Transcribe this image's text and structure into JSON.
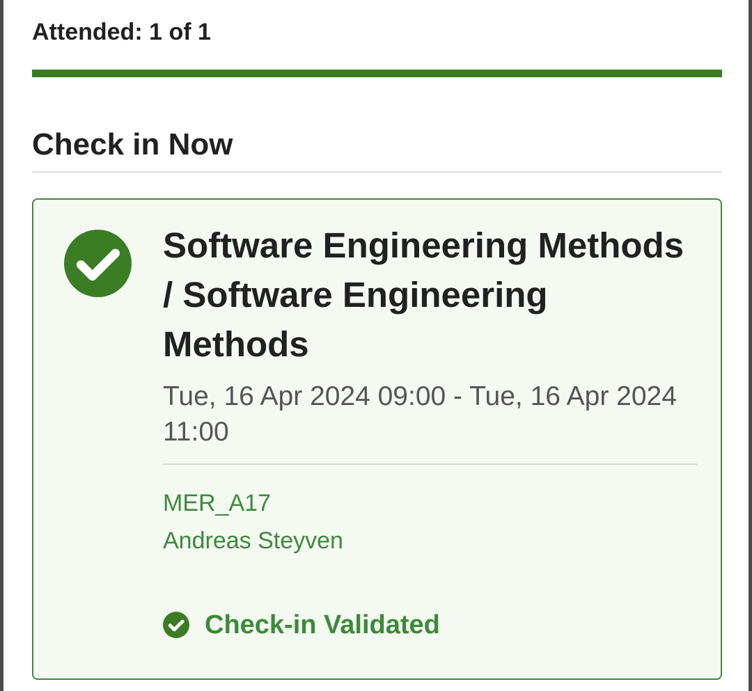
{
  "attendance": {
    "label": "Attended: 1 of 1",
    "progress_fraction": 1.0
  },
  "section": {
    "title": "Check in Now"
  },
  "session": {
    "title": "Software Engineering Methods / Software Engineering Methods",
    "time": "Tue, 16 Apr 2024 09:00 - Tue, 16 Apr 2024 11:00",
    "room": "MER_A17",
    "teacher": "Andreas Steyven",
    "status_label": "Check-in Validated",
    "status_icon": "check-circle-icon"
  },
  "colors": {
    "accent_green": "#3a7d25",
    "card_border": "#3d8a3a",
    "card_background": "#f4f9f2",
    "text_primary": "#212121",
    "text_secondary": "#555555"
  }
}
